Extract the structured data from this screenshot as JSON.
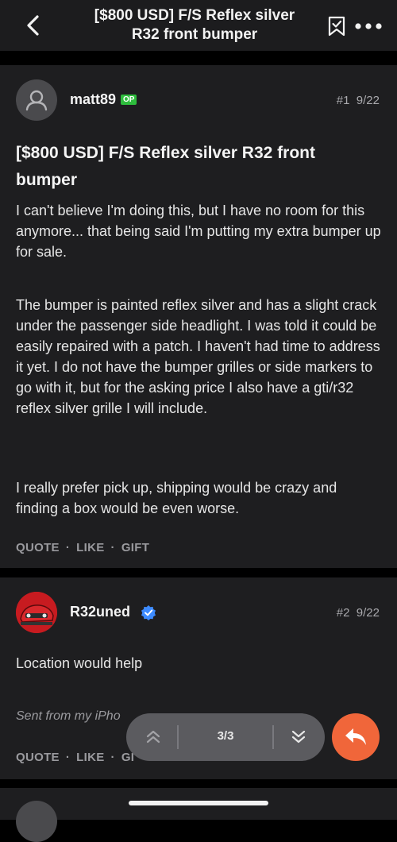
{
  "header": {
    "title": "[$800 USD] F/S Reflex silver R32 front bumper",
    "title_line1": "[$800 USD] F/S Reflex silver",
    "title_line2": "R32 front bumper"
  },
  "posts": [
    {
      "author": "matt89",
      "badge": "OP",
      "number": "#1",
      "date": "9/22",
      "title_line1": "[$800 USD] F/S Reflex silver R32 front",
      "title_line2": "bumper",
      "paragraphs": [
        "I can't believe I'm doing this, but I have no room for this anymore... that being said I'm putting my extra bumper up for sale.",
        "The bumper is painted reflex silver and has a slight crack under the passenger side headlight. I was told it could be easily repaired with a patch. I haven't had time to address it yet. I do not have the bumper grilles or side markers to go with it, but for the asking price I also have a gti/r32 reflex silver grille I will include.",
        "I really prefer pick up, shipping would be crazy and finding a box would be even worse."
      ]
    },
    {
      "author": "R32uned",
      "number": "#2",
      "date": "9/22",
      "body": "Location would help",
      "signature": "Sent from my iPho"
    }
  ],
  "actions": {
    "quote": "QUOTE",
    "like": "LIKE",
    "gift": "GIFT",
    "gift_partial": "GI",
    "separator": "·"
  },
  "pager": {
    "text": "3/3"
  },
  "icons": {
    "back": "chevron-left-icon",
    "bookmark": "bookmark-icon",
    "more": "more-horizontal-icon",
    "default_avatar": "user-icon",
    "verified": "verified-badge-icon",
    "page_up": "double-chevron-up-icon",
    "page_down": "double-chevron-down-icon",
    "reply": "reply-icon"
  },
  "colors": {
    "background": "#000000",
    "surface": "#1e1e20",
    "op_badge": "#2ebd3d",
    "verified": "#3d8bff",
    "reply_button": "#f0663a"
  }
}
